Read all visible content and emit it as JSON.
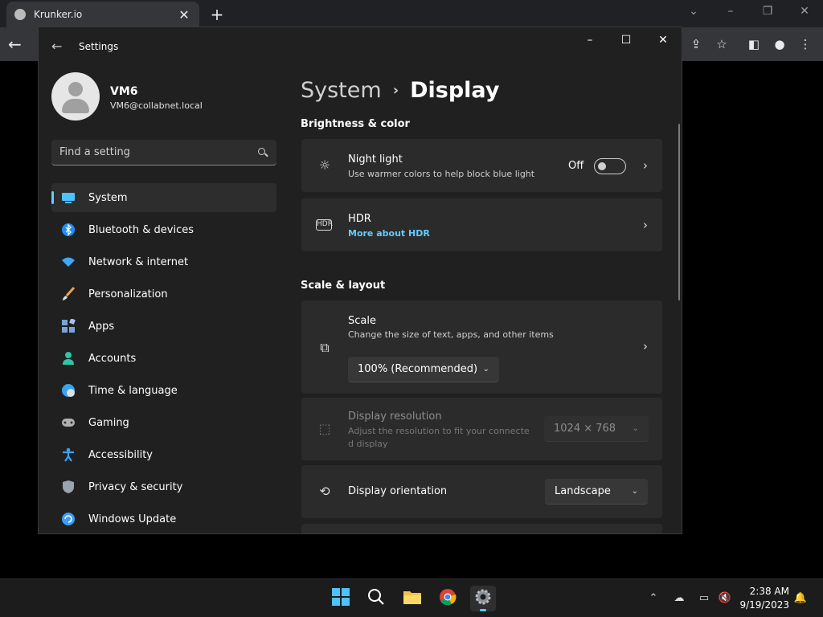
{
  "browser": {
    "tab_title": "Krunker.io",
    "tab_close": "✕",
    "new_tab": "+"
  },
  "settings": {
    "title": "Settings",
    "user": {
      "name": "VM6",
      "email": "VM6@collabnet.local"
    },
    "search": {
      "placeholder": "Find a setting"
    },
    "nav": [
      {
        "label": "System",
        "icon": "monitor-icon",
        "color": "#4cc2ff"
      },
      {
        "label": "Bluetooth & devices",
        "icon": "bluetooth-icon",
        "color": "#1c8ef9"
      },
      {
        "label": "Network & internet",
        "icon": "wifi-icon",
        "color": "#3fa9f5"
      },
      {
        "label": "Personalization",
        "icon": "brush-icon",
        "color": "#e8a35c"
      },
      {
        "label": "Apps",
        "icon": "apps-icon",
        "color": "#7aa3d8"
      },
      {
        "label": "Accounts",
        "icon": "person-icon",
        "color": "#2ec4a8"
      },
      {
        "label": "Time & language",
        "icon": "globe-clock-icon",
        "color": "#3ba2f0"
      },
      {
        "label": "Gaming",
        "icon": "gamepad-icon",
        "color": "#b0b0b0"
      },
      {
        "label": "Accessibility",
        "icon": "accessibility-icon",
        "color": "#3aa0f5"
      },
      {
        "label": "Privacy & security",
        "icon": "shield-icon",
        "color": "#9aa4b0"
      },
      {
        "label": "Windows Update",
        "icon": "update-icon",
        "color": "#3aa0f5"
      }
    ],
    "breadcrumb": {
      "parent": "System",
      "separator": "›",
      "current": "Display"
    },
    "sections": {
      "brightness": "Brightness & color",
      "scale_layout": "Scale & layout"
    },
    "night_light": {
      "title": "Night light",
      "subtitle": "Use warmer colors to help block blue light",
      "state": "Off"
    },
    "hdr": {
      "title": "HDR",
      "link": "More about HDR"
    },
    "scale": {
      "title": "Scale",
      "subtitle": "Change the size of text, apps, and other items",
      "value": "100% (Recommended)"
    },
    "resolution": {
      "title": "Display resolution",
      "subtitle_line1": "Adjust the resolution to fit your connecte",
      "subtitle_line2": "d display",
      "value": "1024 × 768"
    },
    "orientation": {
      "title": "Display orientation",
      "value": "Landscape"
    }
  },
  "taskbar": {
    "time": "2:38 AM",
    "date": "9/19/2023",
    "accent": "#60cdff"
  }
}
